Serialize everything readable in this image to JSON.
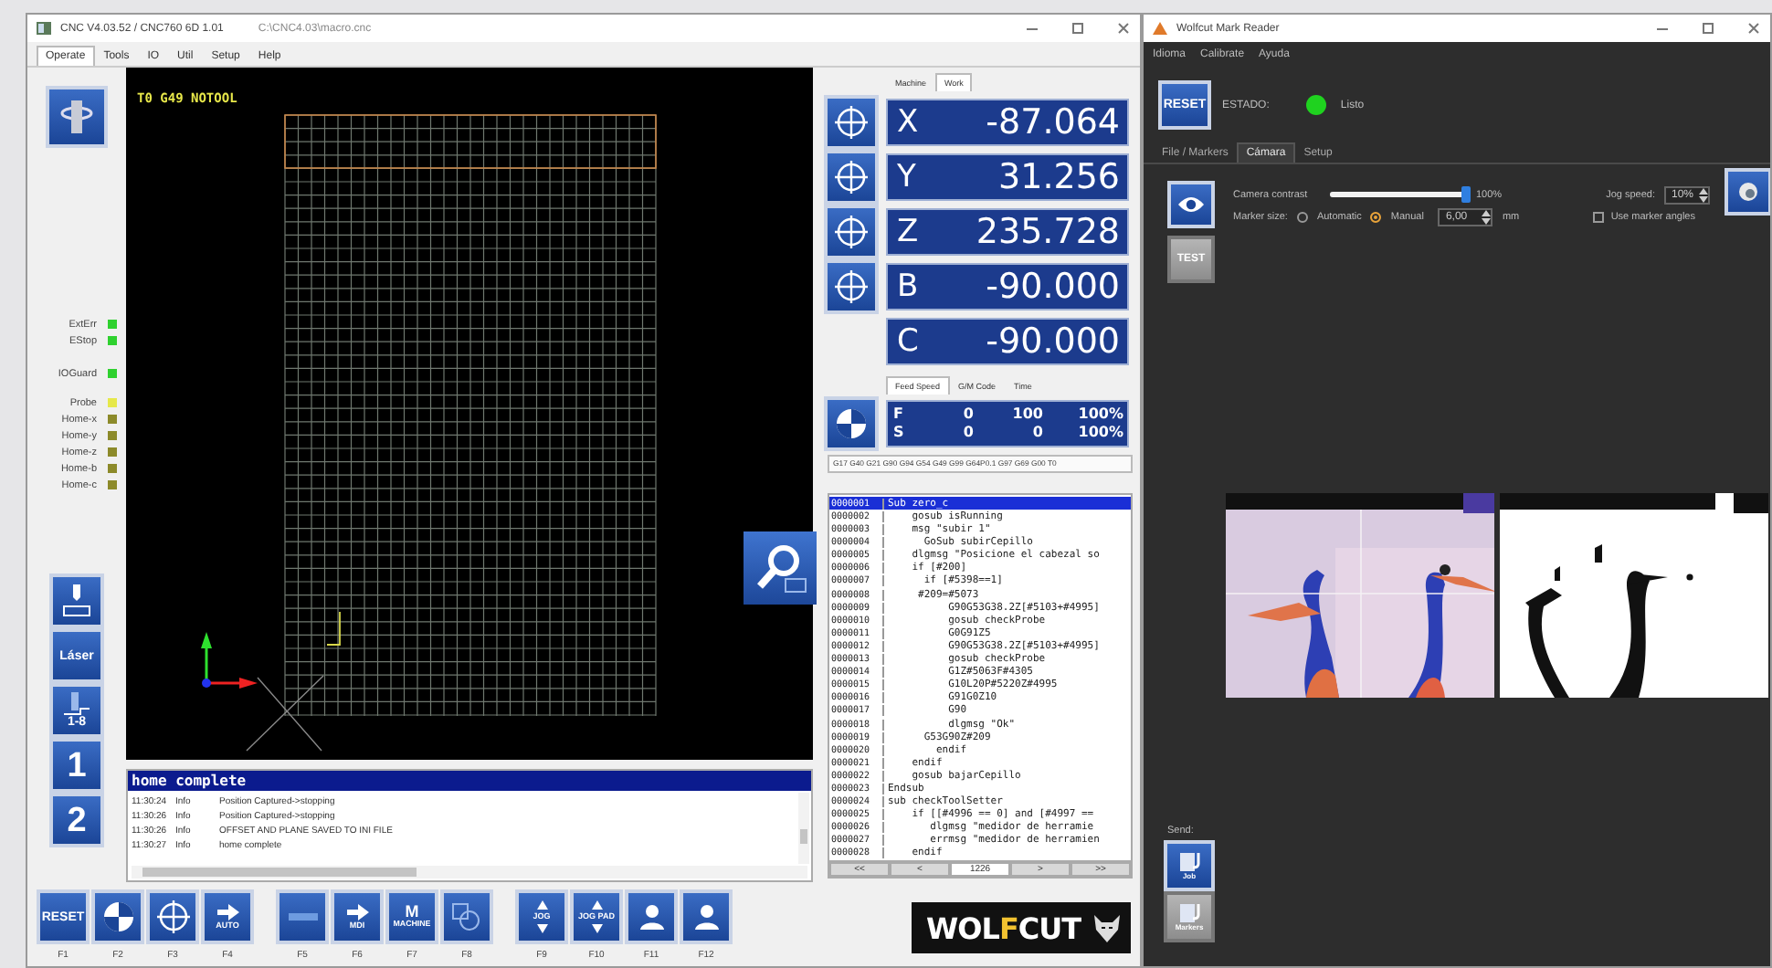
{
  "cnc": {
    "title": "CNC V4.03.52 / CNC760 6D 1.01",
    "file_path": "C:\\CNC4.03\\macro.cnc",
    "tabs": [
      {
        "label": "Operate",
        "selected": true
      },
      {
        "label": "Tools",
        "selected": false
      },
      {
        "label": "IO",
        "selected": false
      },
      {
        "label": "Util",
        "selected": false
      },
      {
        "label": "Setup",
        "selected": false
      },
      {
        "label": "Help",
        "selected": false
      }
    ],
    "viewport": {
      "tool_text": "T0 G49 NOTOOL"
    },
    "leds": [
      {
        "label": "ExtErr",
        "color": "#2fd12f"
      },
      {
        "label": "EStop",
        "color": "#2fd12f"
      },
      {
        "label": "IOGuard",
        "color": "#2fd12f"
      },
      {
        "label": "Probe",
        "color": "#e6e84a"
      },
      {
        "label": "Home-x",
        "color": "#8c8a2a"
      },
      {
        "label": "Home-y",
        "color": "#8c8a2a"
      },
      {
        "label": "Home-z",
        "color": "#8c8a2a"
      },
      {
        "label": "Home-b",
        "color": "#8c8a2a"
      },
      {
        "label": "Home-c",
        "color": "#8c8a2a"
      }
    ],
    "side_buttons": [
      {
        "kind": "tool-setter"
      },
      {
        "kind": "label",
        "text": "Láser"
      },
      {
        "kind": "tool-count",
        "text": "1-8"
      },
      {
        "kind": "number",
        "text": "1"
      },
      {
        "kind": "number",
        "text": "2"
      }
    ],
    "dro_tabs": [
      {
        "label": "Machine",
        "selected": false
      },
      {
        "label": "Work",
        "selected": true
      }
    ],
    "axes": [
      {
        "axis": "X",
        "value": "-87.064",
        "zero_button": true
      },
      {
        "axis": "Y",
        "value": "31.256",
        "zero_button": true
      },
      {
        "axis": "Z",
        "value": "235.728",
        "zero_button": true
      },
      {
        "axis": "B",
        "value": "-90.000",
        "zero_button": true
      },
      {
        "axis": "C",
        "value": "-90.000",
        "zero_button": false
      }
    ],
    "feed_tabs": [
      {
        "label": "Feed Speed",
        "selected": true
      },
      {
        "label": "G/M Code",
        "selected": false
      },
      {
        "label": "Time",
        "selected": false
      }
    ],
    "feed": [
      {
        "letter": "F",
        "actual": "0",
        "set": "100",
        "override": "100%"
      },
      {
        "letter": "S",
        "actual": "0",
        "set": "0",
        "override": "100%"
      }
    ],
    "modal_codes": "G17 G40 G21 G90 G94 G54 G49 G99 G64P0.1 G97 G69 G00 T0",
    "program": {
      "lines": [
        {
          "number": "0000001",
          "code": "Sub zero_c",
          "selected": true
        },
        {
          "number": "0000002",
          "code": "    gosub isRunning",
          "selected": false
        },
        {
          "number": "0000003",
          "code": "    msg \"subir 1\"",
          "selected": false
        },
        {
          "number": "0000004",
          "code": "      GoSub subirCepillo",
          "selected": false
        },
        {
          "number": "0000005",
          "code": "    dlgmsg \"Posicione el cabezal so",
          "selected": false
        },
        {
          "number": "0000006",
          "code": "    if [#200]",
          "selected": false
        },
        {
          "number": "0000007",
          "code": "      if [#5398==1]",
          "selected": false
        },
        {
          "number": "0000008",
          "code": "     #209=#5073",
          "selected": false
        },
        {
          "number": "0000009",
          "code": "          G90G53G38.2Z[#5103+#4995]",
          "selected": false
        },
        {
          "number": "0000010",
          "code": "          gosub checkProbe",
          "selected": false
        },
        {
          "number": "0000011",
          "code": "          G0G91Z5",
          "selected": false
        },
        {
          "number": "0000012",
          "code": "          G90G53G38.2Z[#5103+#4995]",
          "selected": false
        },
        {
          "number": "0000013",
          "code": "          gosub checkProbe",
          "selected": false
        },
        {
          "number": "0000014",
          "code": "          G1Z#5063F#4305",
          "selected": false
        },
        {
          "number": "0000015",
          "code": "          G10L20P#5220Z#4995",
          "selected": false
        },
        {
          "number": "0000016",
          "code": "          G91G0Z10",
          "selected": false
        },
        {
          "number": "0000017",
          "code": "          G90",
          "selected": false
        },
        {
          "number": "0000018",
          "code": "          dlgmsg \"Ok\"",
          "selected": false
        },
        {
          "number": "0000019",
          "code": "      G53G90Z#209",
          "selected": false
        },
        {
          "number": "0000020",
          "code": "        endif",
          "selected": false
        },
        {
          "number": "0000021",
          "code": "    endif",
          "selected": false
        },
        {
          "number": "0000022",
          "code": "    gosub bajarCepillo",
          "selected": false
        },
        {
          "number": "0000023",
          "code": "Endsub",
          "selected": false
        },
        {
          "number": "0000024",
          "code": "sub checkToolSetter",
          "selected": false
        },
        {
          "number": "0000025",
          "code": "    if [[#4996 == 0] and [#4997 ==",
          "selected": false
        },
        {
          "number": "0000026",
          "code": "       dlgmsg \"medidor de herramie",
          "selected": false
        },
        {
          "number": "0000027",
          "code": "       errmsg \"medidor de herramien",
          "selected": false
        },
        {
          "number": "0000028",
          "code": "    endif",
          "selected": false
        }
      ],
      "nav": [
        "<<",
        "<",
        "1226",
        ">",
        ">>"
      ]
    },
    "log": {
      "header": "home complete",
      "entries": [
        {
          "time": "11:30:24",
          "level": "Info",
          "message": "Position Captured->stopping"
        },
        {
          "time": "11:30:26",
          "level": "Info",
          "message": "Position Captured->stopping"
        },
        {
          "time": "11:30:26",
          "level": "Info",
          "message": "OFFSET AND PLANE SAVED TO INI FILE"
        },
        {
          "time": "11:30:27",
          "level": "Info",
          "message": "home complete"
        }
      ]
    },
    "function_keys": [
      {
        "key": "F1",
        "kind": "reset",
        "text": "RESET"
      },
      {
        "key": "F2",
        "kind": "zero"
      },
      {
        "key": "F3",
        "kind": "crosshair"
      },
      {
        "key": "F4",
        "kind": "arrow",
        "text": "AUTO"
      },
      {
        "key": "F5",
        "kind": "blank"
      },
      {
        "key": "F6",
        "kind": "arrow",
        "text": "MDI"
      },
      {
        "key": "F7",
        "kind": "machine",
        "glyph": "M",
        "text": "MACHINE"
      },
      {
        "key": "F8",
        "kind": "shapes"
      },
      {
        "key": "F9",
        "kind": "jog",
        "text": "JOG"
      },
      {
        "key": "F10",
        "kind": "jog",
        "text": "JOG PAD"
      },
      {
        "key": "F11",
        "kind": "user"
      },
      {
        "key": "F12",
        "kind": "user"
      }
    ],
    "logo_parts": [
      "WOL",
      "F",
      "CUT"
    ]
  },
  "reader": {
    "title": "Wolfcut Mark Reader",
    "menu": [
      "Idioma",
      "Calibrate",
      "Ayuda"
    ],
    "reset_label": "RESET",
    "status": {
      "label": "ESTADO:",
      "text": "Listo",
      "ok": true
    },
    "tabs": [
      {
        "label": "File / Markers",
        "selected": false
      },
      {
        "label": "Cámara",
        "selected": true
      },
      {
        "label": "Setup",
        "selected": false
      }
    ],
    "contrast": {
      "label": "Camera contrast",
      "level": 1,
      "reading": "100%"
    },
    "jog_speed": {
      "label": "Jog speed:",
      "value": "10%"
    },
    "marker_size": {
      "label": "Marker size:",
      "options": [
        {
          "label": "Automatic",
          "selected": false
        },
        {
          "label": "Manual",
          "selected": true
        }
      ],
      "value": "6,00",
      "unit": "mm"
    },
    "use_marker_angles": {
      "label": "Use marker angles",
      "checked": false
    },
    "test_button": {
      "label": "TEST",
      "disabled": true
    },
    "send": {
      "label": "Send:",
      "buttons": [
        {
          "label": "Job",
          "disabled": false
        },
        {
          "label": "Markers",
          "disabled": true
        }
      ]
    }
  }
}
